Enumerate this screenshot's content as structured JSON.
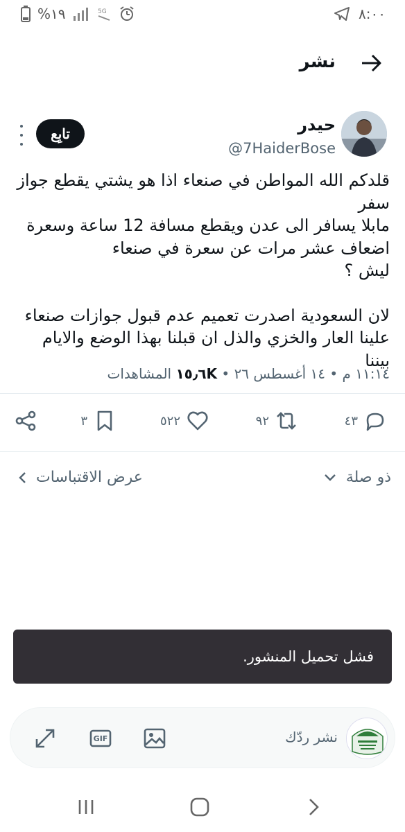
{
  "status_bar": {
    "time": "٨:٠٠",
    "battery": "%١٩",
    "icons": [
      "battery-icon",
      "signal-icon",
      "volte-icon",
      "alarm-icon",
      "telegram-icon"
    ]
  },
  "header": {
    "title": "نشر",
    "back_icon": "arrow-right-icon"
  },
  "tweet": {
    "display_name": "حيدر",
    "handle": "@7HaiderBose",
    "follow_label": "تابِع",
    "lines": [
      "قلدكم الله المواطن في صنعاء اذا هو يشتي يقطع جواز سفر",
      "مابلا يسافر الى عدن ويقطع مسافة 12 ساعة وسعرة اضعاف عشر مرات عن سعرة في صنعاء",
      "ليش ؟"
    ],
    "lines2": [
      "لان السعودية اصدرت تعميم عدم قبول جوازات صنعاء علينا العار والخزي والذل ان قبلنا بهذا الوضع والايام بيننا"
    ],
    "time": "١١:١٤ م",
    "date": "١٤ أغسطس ٢٦",
    "views_count": "١٥٫٦K",
    "views_label": "المشاهدات",
    "sep": "•"
  },
  "actions": {
    "replies": "٤٣",
    "retweets": "٩٢",
    "likes": "٥٢٢",
    "bookmarks": "٣"
  },
  "related": {
    "relevance_label": "ذو صلة",
    "quotes_label": "عرض الاقتباسات"
  },
  "toast": {
    "message": "فشل تحميل المنشور."
  },
  "composer": {
    "placeholder": "نشر ردّك",
    "gif_label": "GIF"
  }
}
